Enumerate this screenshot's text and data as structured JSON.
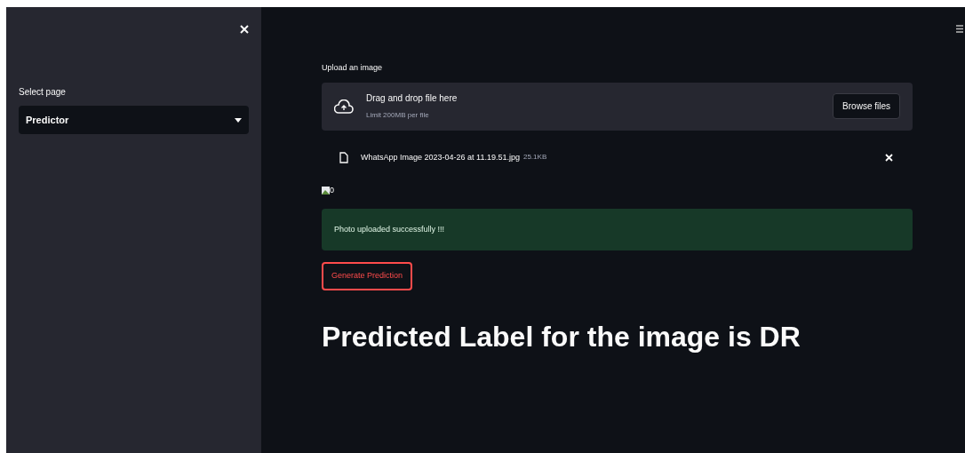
{
  "sidebar": {
    "select_label": "Select page",
    "select_value": "Predictor"
  },
  "uploader": {
    "label": "Upload an image",
    "drop_text": "Drag and drop file here",
    "limit_text": "Limit 200MB per file",
    "browse_button": "Browse files"
  },
  "file": {
    "name": "WhatsApp Image 2023-04-26 at 11.19.51.jpg",
    "size": "25.1KB"
  },
  "image": {
    "alt": "0"
  },
  "success": {
    "message": "Photo uploaded successfully !!!"
  },
  "predict_button": "Generate Prediction",
  "result": "Predicted Label for the image is DR"
}
